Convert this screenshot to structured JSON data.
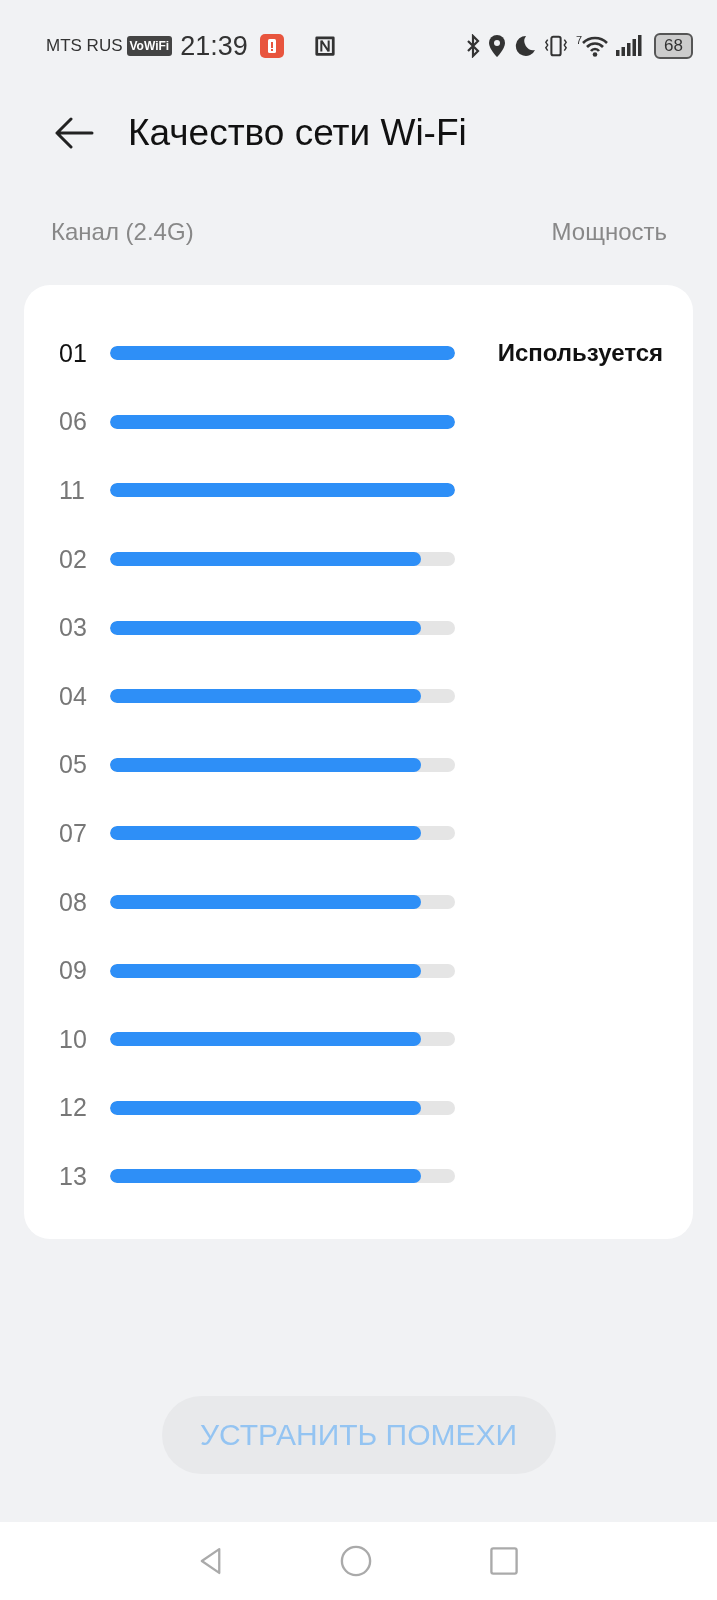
{
  "status_bar": {
    "carrier": "MTS RUS",
    "vowifi_badge": "VoWiFi",
    "time": "21:39",
    "wifi_generation": "7",
    "battery": "68"
  },
  "header": {
    "title": "Качество сети Wi-Fi"
  },
  "columns": {
    "channel": "Канал (2.4G)",
    "power": "Мощность"
  },
  "channels": [
    {
      "channel": "01",
      "level": 1,
      "selected": true,
      "status": "Используется"
    },
    {
      "channel": "06",
      "level": 1,
      "selected": false
    },
    {
      "channel": "11",
      "level": 1,
      "selected": false
    },
    {
      "channel": "02",
      "level": 0.9,
      "selected": false
    },
    {
      "channel": "03",
      "level": 0.9,
      "selected": false
    },
    {
      "channel": "04",
      "level": 0.9,
      "selected": false
    },
    {
      "channel": "05",
      "level": 0.9,
      "selected": false
    },
    {
      "channel": "07",
      "level": 0.9,
      "selected": false
    },
    {
      "channel": "08",
      "level": 0.9,
      "selected": false
    },
    {
      "channel": "09",
      "level": 0.9,
      "selected": false
    },
    {
      "channel": "10",
      "level": 0.9,
      "selected": false
    },
    {
      "channel": "12",
      "level": 0.9,
      "selected": false
    },
    {
      "channel": "13",
      "level": 0.9,
      "selected": false
    }
  ],
  "fix_button": {
    "label": "УСТРАНИТЬ ПОМЕХИ",
    "disabled": true
  }
}
